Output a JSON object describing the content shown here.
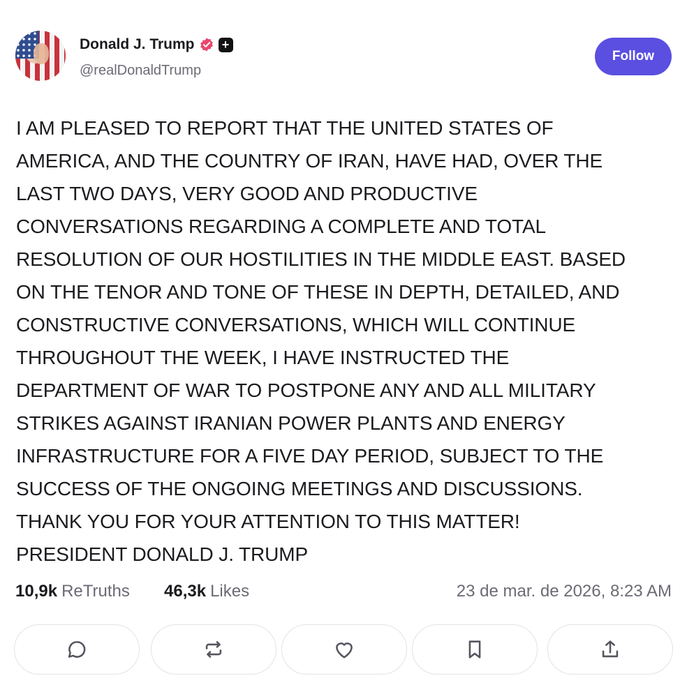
{
  "author": {
    "name": "Donald J. Trump",
    "handle": "@realDonaldTrump",
    "verified_icon": "verified-badge-icon",
    "extra_icon": "plus-badge-icon",
    "plus_glyph": "+"
  },
  "follow_button": {
    "label": "Follow",
    "color": "#5a4fe0"
  },
  "post": {
    "lines": [
      "I AM PLEASED TO REPORT THAT THE UNITED STATES OF",
      "AMERICA, AND THE COUNTRY OF IRAN, HAVE HAD, OVER THE",
      "LAST TWO DAYS, VERY GOOD AND PRODUCTIVE",
      "CONVERSATIONS REGARDING A COMPLETE AND TOTAL",
      "RESOLUTION OF OUR HOSTILITIES IN THE MIDDLE EAST. BASED",
      "ON THE TENOR AND TONE OF THESE IN DEPTH, DETAILED, AND",
      "CONSTRUCTIVE CONVERSATIONS, WHICH WILL CONTINUE",
      "THROUGHOUT THE WEEK, I HAVE INSTRUCTED THE",
      "DEPARTMENT OF WAR TO POSTPONE ANY AND ALL MILITARY",
      "STRIKES AGAINST IRANIAN POWER PLANTS AND ENERGY",
      "INFRASTRUCTURE FOR A FIVE DAY PERIOD, SUBJECT TO THE",
      "SUCCESS OF THE ONGOING MEETINGS AND DISCUSSIONS.",
      "THANK YOU FOR YOUR ATTENTION TO THIS MATTER!",
      "PRESIDENT DONALD J. TRUMP"
    ]
  },
  "stats": {
    "retruths_count": "10,9k",
    "retruths_label": "ReTruths",
    "likes_count": "46,3k",
    "likes_label": "Likes",
    "timestamp": "23 de mar. de 2026, 8:23 AM"
  },
  "actions": [
    "reply-icon",
    "retruth-icon",
    "heart-icon",
    "bookmark-icon",
    "share-icon"
  ],
  "colors": {
    "verified_badge": "#e9466c",
    "text": "#1b1b1f",
    "muted": "#6b6b75",
    "icon": "#55555f"
  }
}
